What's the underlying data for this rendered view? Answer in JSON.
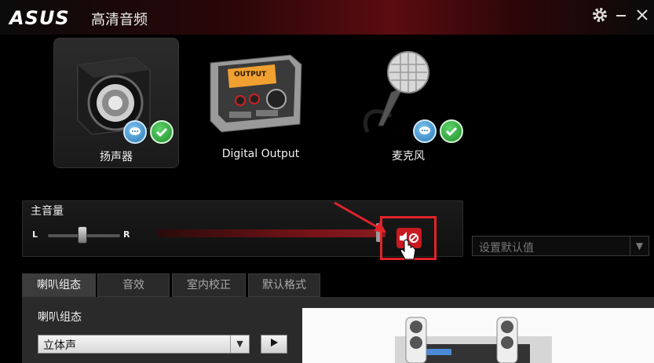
{
  "app": {
    "brand": "ASUS",
    "title": "高清音频"
  },
  "devices": [
    {
      "label": "扬声器",
      "selected": true,
      "icon": "speaker-icon"
    },
    {
      "label": "Digital Output",
      "selected": false,
      "icon": "digital-output-icon",
      "panel_text": "OUTPUT"
    },
    {
      "label": "麦克风",
      "selected": false,
      "icon": "microphone-icon"
    }
  ],
  "volume": {
    "title": "主音量",
    "balance_left": "L",
    "balance_right": "R",
    "balance_level": 0.5,
    "master_level": 0.95,
    "muted": true
  },
  "default_select": {
    "value": "设置默认值"
  },
  "tabs": [
    {
      "label": "喇叭组态",
      "active": true
    },
    {
      "label": "音效",
      "active": false
    },
    {
      "label": "室内校正",
      "active": false
    },
    {
      "label": "默认格式",
      "active": false
    }
  ],
  "speaker_config": {
    "section_label": "喇叭组态",
    "selected_value": "立体声"
  },
  "colors": {
    "accent_red": "#e0232a",
    "title_red": "#5a0c10",
    "check_green": "#1e8f2c",
    "chat_blue": "#2a78b8"
  }
}
